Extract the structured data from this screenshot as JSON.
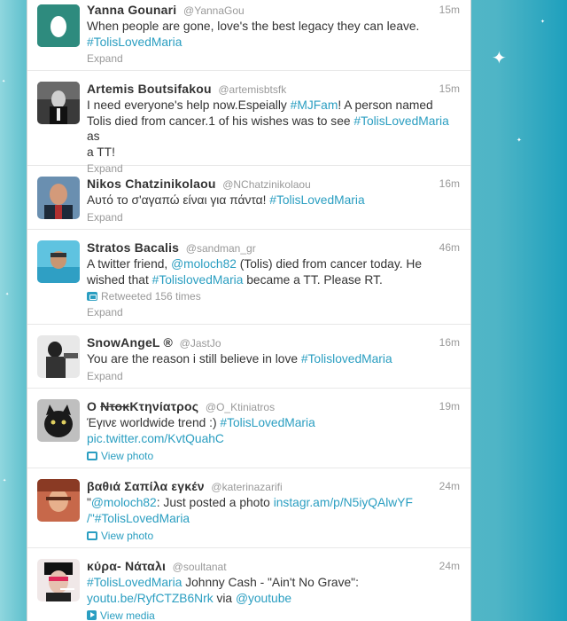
{
  "tweets": [
    {
      "fullname": "Yanna Gounari",
      "screen": "@YannaGou",
      "time": "15m",
      "text_parts": [
        "When people are gone, love's the best legacy they can leave."
      ],
      "hashtag": "#TolisLovedMaria",
      "action": "Expand"
    },
    {
      "fullname": "Artemis Boutsifakou",
      "screen": "@artemisbtsfk",
      "time": "15m",
      "line1_a": "I need everyone's help now.Espeially ",
      "line1_tag": "#MJFam",
      "line1_b": "! A person named",
      "line2_a": "Tolis died from cancer.1 of his wishes was to see ",
      "line2_tag": "#TolisLovedMaria",
      "line2_b": " as",
      "line3": "a TT!",
      "action": "Expand"
    },
    {
      "fullname": "Nikos Chatzinikolaou",
      "screen": "@NChatzinikolaou",
      "time": "16m",
      "text_a": "Αυτό το σ'αγαπώ είναι για πάντα! ",
      "tag": "#TolisLovedMaria",
      "action": "Expand"
    },
    {
      "fullname": "Stratos Bacalis",
      "screen": "@sandman_gr",
      "time": "46m",
      "line1_a": "A twitter friend, ",
      "line1_mention": "@moloch82",
      "line1_b": " (Tolis) died from cancer today. He",
      "line2_a": "wished that ",
      "line2_tag": "#TolislovedMaria",
      "line2_b": " became a TT. Please RT.",
      "retweeted": "Retweeted 156 times",
      "action": "Expand"
    },
    {
      "fullname": "SnowAngeL ®",
      "screen": "@JastJo",
      "time": "16m",
      "text_a": "You are the reason i still believe in love ",
      "tag": "#TolislovedMaria",
      "action": "Expand"
    },
    {
      "fullname_a": "Ο ",
      "fullname_strike": "Ντοκ",
      "fullname_b": "Κτηνίατρος",
      "screen": "@O_Ktiniatros",
      "time": "19m",
      "text_a": "Έγινε worldwide trend :) ",
      "tag": "#TolisLovedMaria",
      "link": "pic.twitter.com/KvtQuahC",
      "action": "View photo"
    },
    {
      "fullname": "βαθιά Σαπίλα εγκέν",
      "screen": "@katerinazarifi",
      "time": "24m",
      "line1_a": "\"",
      "line1_mention": "@moloch82",
      "line1_b": ": Just posted a photo ",
      "line1_link": "instagr.am/p/N5iyQAlwYF",
      "line2_a": "/\"",
      "line2_tag": "#TolisLovedMaria",
      "action": "View photo"
    },
    {
      "fullname": "κύρα- Νάταλι",
      "screen": "@soultanat",
      "time": "24m",
      "line1_tag": "#TolisLovedMaria",
      "line1_b": " Johnny Cash - \"Ain't No Grave\":",
      "line2_link": "youtu.be/RyfCTZB6Nrk",
      "line2_b": " via ",
      "line2_mention": "@youtube",
      "action": "View media"
    }
  ]
}
